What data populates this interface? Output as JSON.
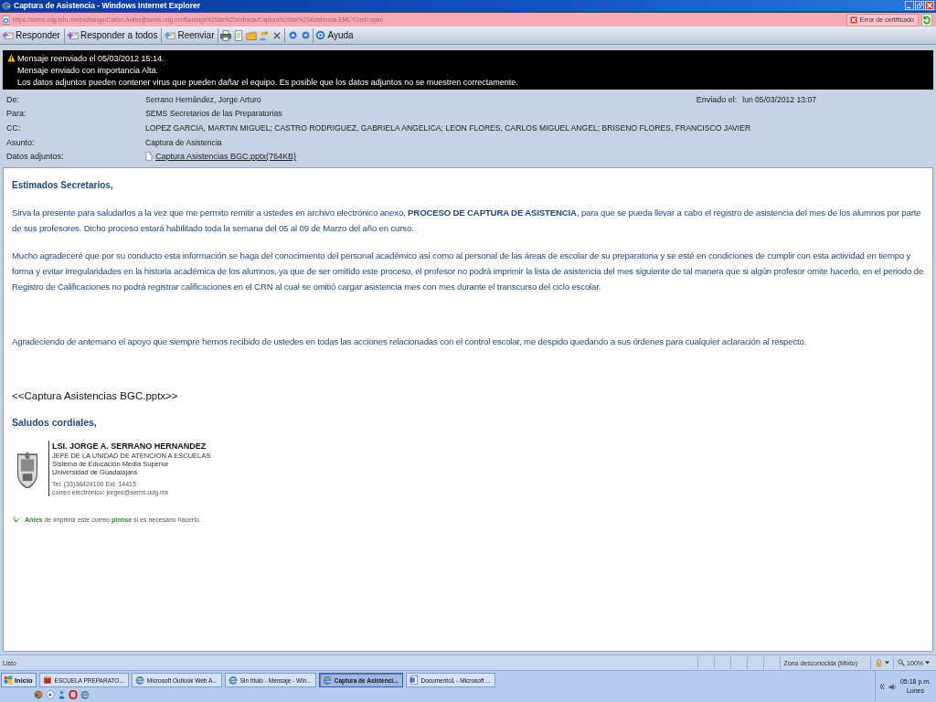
{
  "window": {
    "title": "Captura de Asistencia - Windows Internet Explorer"
  },
  "address_bar": {
    "url": "https://sems.udg.edu.mx/exchange/Carlos.Aviles@sems.udg.mx/Bandeja%20de%20entrada/Captura%20de%20Asistencia.EML?Cmd=open",
    "certificate_error": "Error de certificado"
  },
  "toolbar": {
    "buttons": [
      "Responder",
      "Responder a todos",
      "Reenviar"
    ],
    "help": "Ayuda"
  },
  "banner": {
    "lines": [
      "Mensaje reenviado el 05/03/2012 15:14.",
      "Mensaje enviado con importancia Alta.",
      "Los datos adjuntos pueden contener virus que pueden dañar el equipo. Es posible que los datos adjuntos no se muestren correctamente."
    ]
  },
  "header": {
    "fields": [
      {
        "kind": "text",
        "label": "De:",
        "value": "Serrano Hernández, Jorge Arturo"
      },
      {
        "kind": "text",
        "label": "Para:",
        "value": "SEMS Secretarios de las Preparatorias"
      },
      {
        "kind": "text",
        "label": "CC:",
        "value": "LOPEZ GARCIA, MARTIN MIGUEL; CASTRO RODRIGUEZ, GABRIELA ANGELICA; LEON FLORES, CARLOS MIGUEL ANGEL; BRISENO FLORES, FRANCISCO JAVIER"
      },
      {
        "kind": "text",
        "label": "Asunto:",
        "value": "Captura de Asistencia"
      },
      {
        "kind": "attachment",
        "label": "Datos adjuntos:",
        "value": "Captura Asistencias BGC.pptx(764KB)"
      }
    ],
    "sent": {
      "label": "Enviado el:",
      "value": "lun 05/03/2012 13:07"
    }
  },
  "body": {
    "greeting": "Estimados Secretarios,",
    "paragraphs": [
      "Sirva la presente para saludarlos a la vez que me permito remitir a ustedes en archivo electrónico anexo, **PROCESO DE CAPTURA DE ASISTENCIA**, para que se pueda llevar a cabo el registro de asistencia del mes de los alumnos por parte de sus profesores. Dicho proceso estará habilitado toda la semana del 05 al 09 de Marzo del año en curso.",
      "Mucho agradeceré que por su conducto esta información se haga del conocimiento del personal académico así como al personal de las áreas de escolar de su preparatoria y se esté en condiciones de cumplir con esta actividad en tiempo y forma y evitar irregularidades en la historia académica de los alumnos, ya que de ser omitido este proceso, el profesor no podrá imprimir la lista de asistencia del mes siguiente de tal manera que si algún profesor omite hacerlo, en el periodo de Registro de Calificaciones no podrá registrar calificaciones en el CRN al cual se omitió cargar asistencia mes con mes durante el transcurso del ciclo escolar.",
      "Agradeciendo de antemano el apoyo que siempre hemos recibido de ustedes en todas las acciones relacionadas con el control escolar, me despido quedando a sus órdenes para cualquier aclaración al respecto."
    ],
    "attachment_ref": "<<Captura Asistencias BGC.pptx>>",
    "closing": "Saludos cordiales,"
  },
  "signature": {
    "name": "LSI. JORGE A. SERRANO HERNANDEZ",
    "lines": [
      "JEFE DE LA UNIDAD DE ATENCION A ESCUELAS",
      "Sistema de Educación Media Superior",
      "Universidad de Guadalajara"
    ],
    "contact": [
      "Tel. (33)38424100 Ext. 14415",
      "correo electrónico: jorges@sems.udg.mx"
    ]
  },
  "print_note": "**Antes** de imprimir este correo **piense** si es necesario hacerlo.",
  "status_bar": {
    "text": "Listo",
    "zone": "Zona desconocida (Mixto)",
    "zoom": "100%"
  },
  "taskbar": {
    "start": "Inicio",
    "tasks": [
      {
        "kind": "program",
        "label": "ESCUELA PREPARATO...",
        "selected": false
      },
      {
        "kind": "browser",
        "label": "Microsoft Outlook Web A...",
        "selected": false
      },
      {
        "kind": "browser",
        "label": "Sin título - Mensaje - Win...",
        "selected": false
      },
      {
        "kind": "browser",
        "label": "Captura de Asistenci...",
        "selected": true
      },
      {
        "kind": "document",
        "label": "Documento1 - Microsoft ...",
        "selected": false
      }
    ],
    "clock": "05:18 p.m.",
    "day": "Lunes"
  }
}
